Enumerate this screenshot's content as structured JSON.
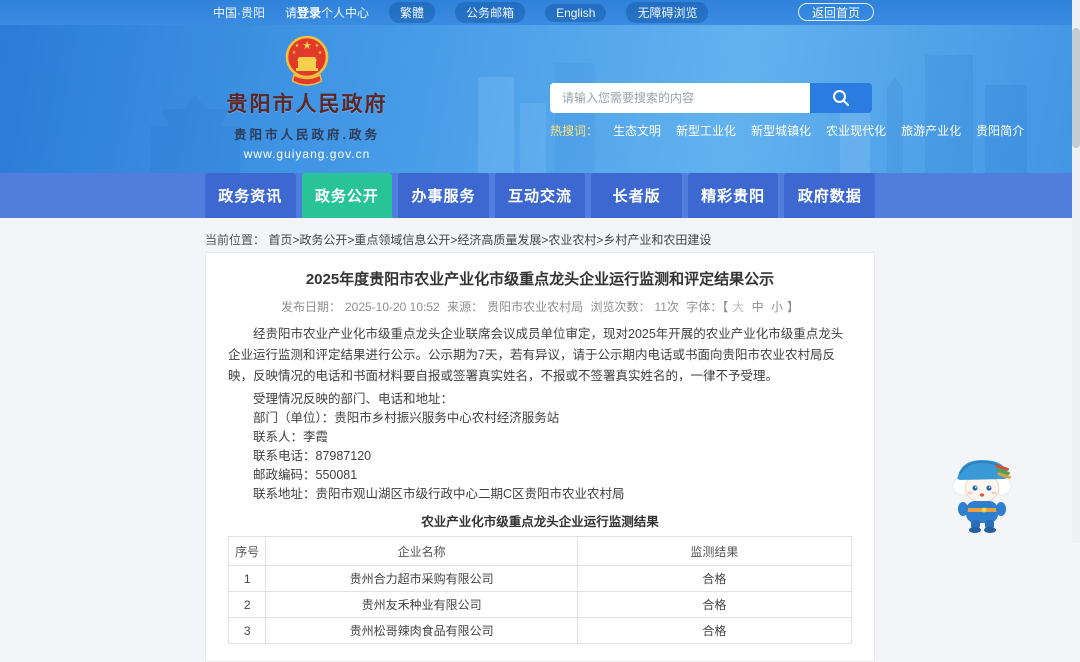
{
  "top_bar": {
    "region": "中国·贵阳",
    "login_pre": "请",
    "login_bold": "登录",
    "login_post": "个人中心",
    "pills": [
      "繁體",
      "公务邮箱",
      "English",
      "无障碍浏览"
    ],
    "home_button": "返回首页"
  },
  "site": {
    "name": "贵阳市人民政府",
    "subtitle": "贵阳市人民政府.政务",
    "url": "www.guiyang.gov.cn"
  },
  "search": {
    "placeholder": "请输入您需要搜索的内容",
    "hot_label": "热搜词：",
    "hot_words": [
      "生态文明",
      "新型工业化",
      "新型城镇化",
      "农业现代化",
      "旅游产业化",
      "贵阳简介"
    ]
  },
  "nav": {
    "items": [
      {
        "label": "政务资讯"
      },
      {
        "label": "政务公开"
      },
      {
        "label": "办事服务"
      },
      {
        "label": "互动交流"
      },
      {
        "label": "长者版"
      },
      {
        "label": "精彩贵阳"
      },
      {
        "label": "政府数据"
      }
    ]
  },
  "breadcrumb": {
    "label": "当前位置：",
    "path": "首页>政务公开>重点领域信息公开>经济高质量发展>农业农村>乡村产业和农田建设"
  },
  "article": {
    "title": "2025年度贵阳市农业产业化市级重点龙头企业运行监测和评定结果公示",
    "meta": {
      "publish_label": "发布日期：",
      "publish_value": "2025-10-20 10:52",
      "source_label": "来源：",
      "source_value": "贵阳市农业农村局",
      "views_label": "浏览次数：",
      "views_value": "11次",
      "font_label": "字体：【",
      "font_sizes": [
        "大",
        "中",
        "小"
      ],
      "font_suffix": "】"
    },
    "paragraphs": {
      "intro": "经贵阳市农业产业化市级重点龙头企业联席会议成员单位审定，现对2025年开展的农业产业化市级重点龙头企业运行监测和评定结果进行公示。公示期为7天，若有异议，请于公示期内电话或书面向贵阳市农业农村局反映，反映情况的电话和书面材料要自报或签署真实姓名，不报或不签署真实姓名的，一律不予受理。",
      "accept_header": "受理情况反映的部门、电话和地址：",
      "dept": "部门（单位）：贵阳市乡村振兴服务中心农村经济服务站",
      "contact": "联系人：李霞",
      "phone": "联系电话：87987120",
      "postcode": "邮政编码：550081",
      "address": "联系地址：贵阳市观山湖区市级行政中心二期C区贵阳市农业农村局"
    },
    "table": {
      "title": "农业产业化市级重点龙头企业运行监测结果",
      "headers": [
        "序号",
        "企业名称",
        "监测结果"
      ],
      "rows": [
        [
          "1",
          "贵州合力超市采购有限公司",
          "合格"
        ],
        [
          "2",
          "贵州友禾种业有限公司",
          "合格"
        ],
        [
          "3",
          "贵州松哥辣肉食品有限公司",
          "合格"
        ]
      ]
    }
  },
  "colors": {
    "nav_active_green": "#29c398",
    "nav_blue": "#3c68d0",
    "banner_blue": "#3f93e2",
    "brand_text_red": "#5c2727",
    "search_button_blue": "#2a7ce0"
  },
  "icons": {
    "emblem": "national-emblem",
    "search": "search-icon",
    "mascot": "mascot-figure"
  }
}
